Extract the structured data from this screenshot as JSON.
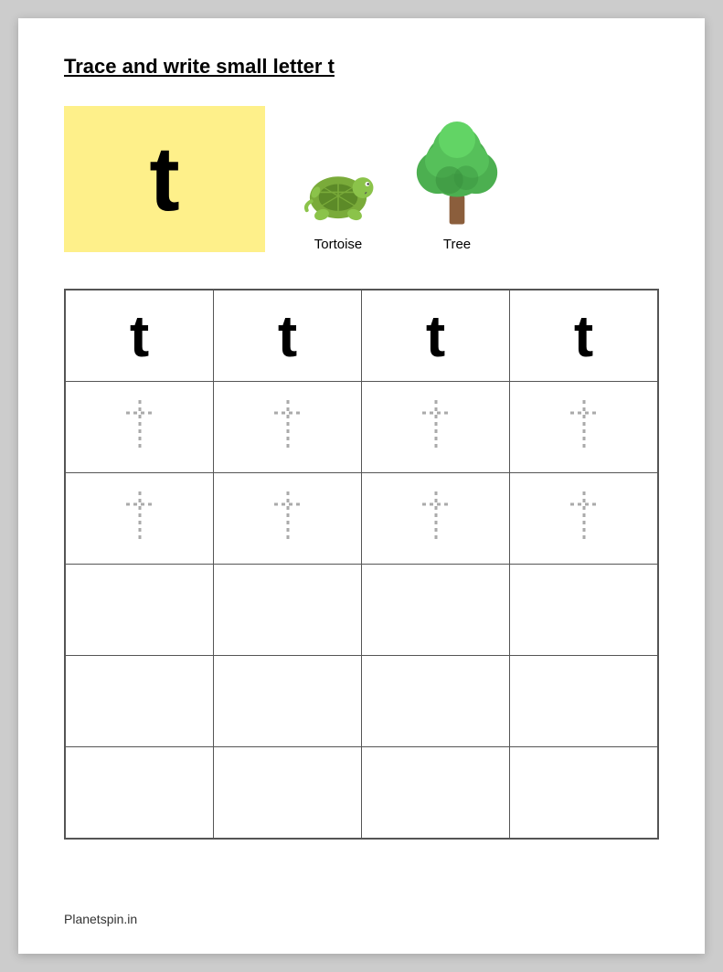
{
  "page": {
    "title": "Trace and write small letter t",
    "footer": "Planetspin.in",
    "images": [
      {
        "name": "tortoise",
        "label": "Tortoise"
      },
      {
        "name": "tree",
        "label": "Tree"
      }
    ],
    "grid": {
      "rows": 6,
      "cols": 4,
      "solid_rows": 1,
      "dotted_rows": 2,
      "empty_rows": 3
    }
  }
}
